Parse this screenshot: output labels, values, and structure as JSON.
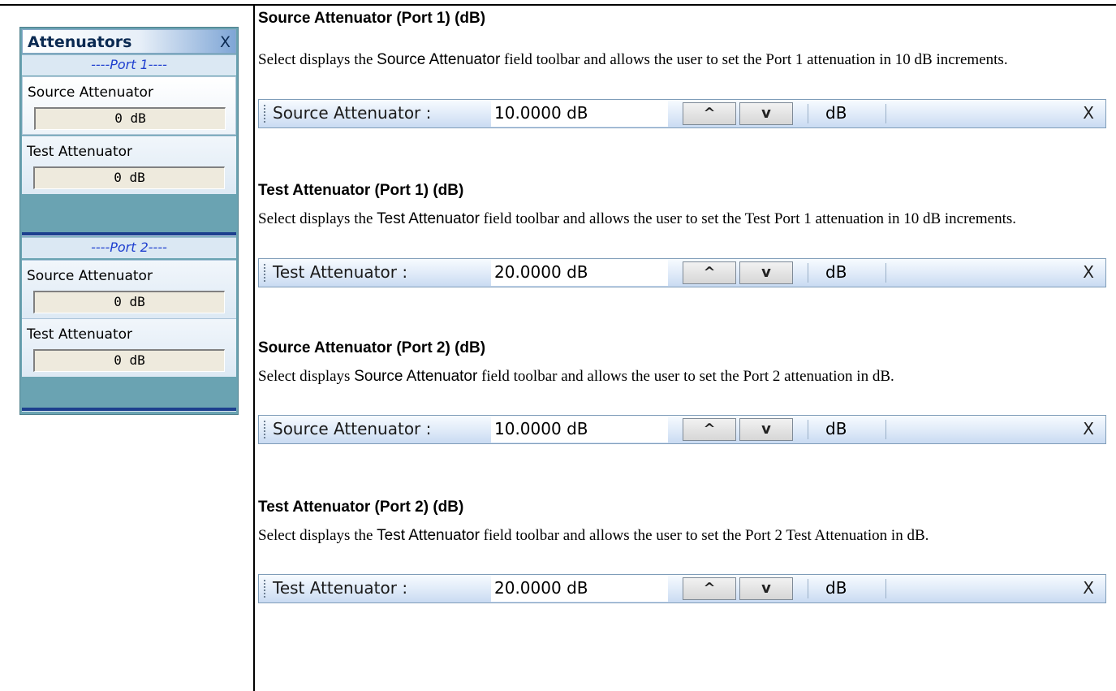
{
  "panel": {
    "title": "Attenuators",
    "close": "X",
    "port1_header": "----Port 1----",
    "port2_header": "----Port 2----",
    "items": [
      {
        "label": "Source Attenuator",
        "value": "0 dB"
      },
      {
        "label": "Test Attenuator",
        "value": "0 dB"
      },
      {
        "label": "Source Attenuator",
        "value": "0 dB"
      },
      {
        "label": "Test Attenuator",
        "value": "0 dB"
      }
    ]
  },
  "sections": [
    {
      "heading": "Source Attenuator (Port 1) (dB)",
      "text_before": "Select displays the ",
      "ui_term": "Source Attenuator",
      "text_after": " field toolbar and allows the user to set the Port 1 attenuation in 10 dB increments.",
      "toolbar": {
        "label": "Source Attenuator :",
        "value": "10.0000  dB",
        "up": "^",
        "down": "v",
        "unit": "dB",
        "close": "X"
      }
    },
    {
      "heading": "Test Attenuator (Port 1) (dB)",
      "text_before": "Select displays the ",
      "ui_term": "Test Attenuator",
      "text_after": " field toolbar and allows the user to set the Test Port 1 attenuation in 10 dB increments.",
      "toolbar": {
        "label": "Test Attenuator :",
        "value": "20.0000  dB",
        "up": "^",
        "down": "v",
        "unit": "dB",
        "close": "X"
      }
    },
    {
      "heading": "Source Attenuator (Port 2) (dB)",
      "text_before": "Select displays ",
      "ui_term": "Source Attenuator",
      "text_after": " field toolbar and allows the user to set the Port 2 attenuation in dB.",
      "toolbar": {
        "label": "Source Attenuator :",
        "value": "10.0000  dB",
        "up": "^",
        "down": "v",
        "unit": "dB",
        "close": "X"
      }
    },
    {
      "heading": "Test Attenuator (Port 2) (dB)",
      "text_before": "Select displays the ",
      "ui_term": "Test Attenuator",
      "text_after": " field toolbar and allows the user to set the Port 2 Test Attenuation in dB.",
      "toolbar": {
        "label": "Test Attenuator :",
        "value": "20.0000  dB",
        "up": "^",
        "down": "v",
        "unit": "dB",
        "close": "X"
      }
    }
  ]
}
